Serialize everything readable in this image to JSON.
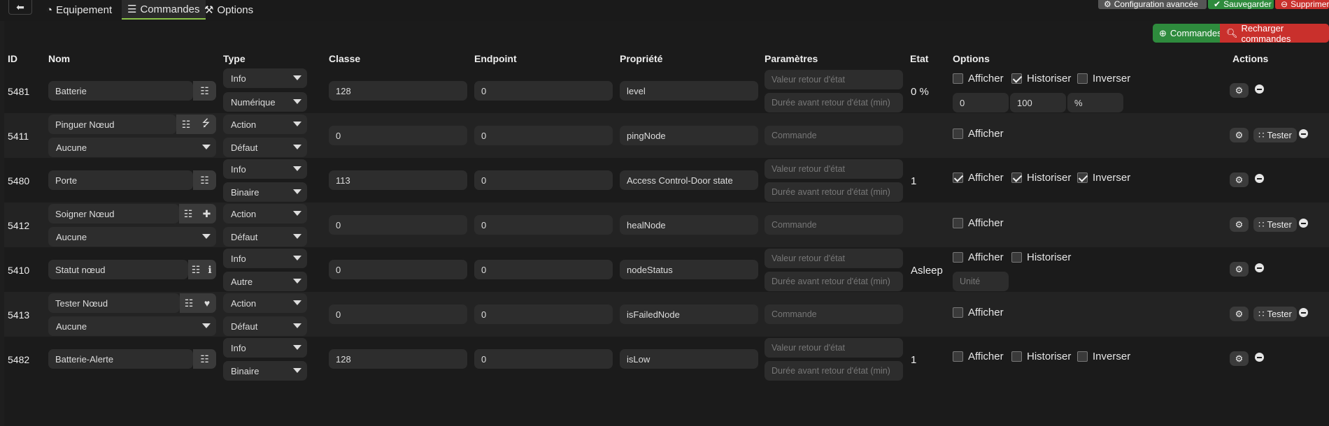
{
  "nav": {
    "tabs": [
      {
        "label": "Equipement",
        "icon": "tachometer-icon"
      },
      {
        "label": "Commandes",
        "icon": "list-icon"
      },
      {
        "label": "Options",
        "icon": "wrench-icon"
      }
    ],
    "active_tab": "Commandes"
  },
  "top_actions": {
    "config_label": "Configuration avancée",
    "save_label": "Sauvegarder",
    "delete_label": "Supprimer"
  },
  "toolbar": {
    "add_label": "Commandes",
    "reload_label": "Recharger commandes"
  },
  "columns": [
    "ID",
    "Nom",
    "Type",
    "Classe",
    "Endpoint",
    "Propriété",
    "Paramètres",
    "Etat",
    "Options",
    "Actions"
  ],
  "rows": [
    {
      "id": "5481",
      "name": "Batterie",
      "name_icon": "zwave-icon",
      "type": "Info",
      "subtype": "Numérique",
      "classe": "128",
      "endpoint": "0",
      "property": "level",
      "param1": "Valeur retour d'état",
      "param2": "Durée avant retour d'état (min)",
      "etat": "0 %",
      "afficher": false,
      "historiser": true,
      "inverser": false,
      "min": "0",
      "max": "100",
      "unit": "%",
      "tester": false
    },
    {
      "id": "5411",
      "name": "Pinguer Nœud",
      "name_icon": "sitemap-icon",
      "value_select": "Aucune",
      "type": "Action",
      "subtype": "Défaut",
      "classe": "0",
      "endpoint": "0",
      "property": "pingNode",
      "param1": "Commande",
      "etat": "",
      "afficher": false,
      "tester": true
    },
    {
      "id": "5480",
      "name": "Porte",
      "name_icon": "zwave-icon",
      "type": "Info",
      "subtype": "Binaire",
      "classe": "113",
      "endpoint": "0",
      "property": "Access Control-Door state",
      "param1": "Valeur retour d'état",
      "param2": "Durée avant retour d'état (min)",
      "etat": "1",
      "afficher": true,
      "historiser": true,
      "inverser": true,
      "tester": false
    },
    {
      "id": "5412",
      "name": "Soigner Nœud",
      "name_icon": "medkit-icon",
      "value_select": "Aucune",
      "type": "Action",
      "subtype": "Défaut",
      "classe": "0",
      "endpoint": "0",
      "property": "healNode",
      "param1": "Commande",
      "etat": "",
      "afficher": false,
      "tester": true
    },
    {
      "id": "5410",
      "name": "Statut nœud",
      "name_icon": "info-icon",
      "type": "Info",
      "subtype": "Autre",
      "classe": "0",
      "endpoint": "0",
      "property": "nodeStatus",
      "param1": "Valeur retour d'état",
      "param2": "Durée avant retour d'état (min)",
      "etat": "Asleep",
      "afficher": false,
      "historiser": false,
      "unit_placeholder": "Unité",
      "tester": false
    },
    {
      "id": "5413",
      "name": "Tester Nœud",
      "name_icon": "heartbeat-icon",
      "value_select": "Aucune",
      "type": "Action",
      "subtype": "Défaut",
      "classe": "0",
      "endpoint": "0",
      "property": "isFailedNode",
      "param1": "Commande",
      "etat": "",
      "afficher": false,
      "tester": true
    },
    {
      "id": "5482",
      "name": "Batterie-Alerte",
      "name_icon": "zwave-icon",
      "type": "Info",
      "subtype": "Binaire",
      "classe": "128",
      "endpoint": "0",
      "property": "isLow",
      "param1": "Valeur retour d'état",
      "param2": "Durée avant retour d'état (min)",
      "etat": "1",
      "afficher": false,
      "historiser": false,
      "inverser": false,
      "tester": false
    }
  ],
  "labels": {
    "afficher": "Afficher",
    "historiser": "Historiser",
    "inverser": "Inverser",
    "tester": "Tester"
  },
  "colors": {
    "accent": "#8bc34a",
    "green": "#2e8b3d",
    "red": "#c9302c",
    "background": "#1e1e1e"
  }
}
